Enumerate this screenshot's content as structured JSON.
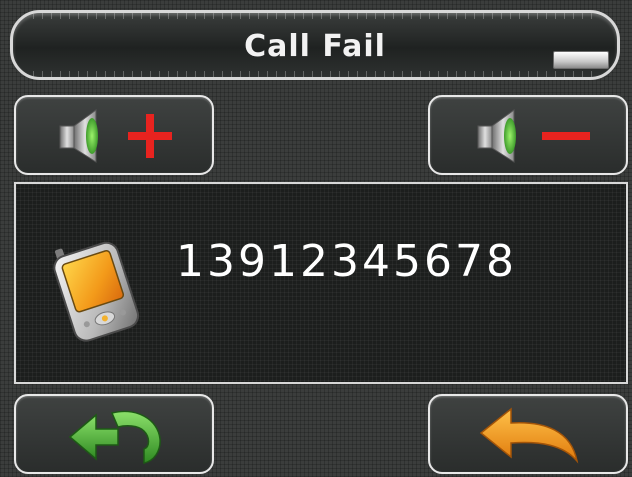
{
  "title": "Call Fail",
  "phone_number": "13912345678",
  "icons": {
    "minimize": "minimize-icon",
    "volume_up": "speaker-plus-icon",
    "volume_down": "speaker-minus-icon",
    "device": "pda-phone-icon",
    "redial": "redial-arrow-icon",
    "back": "back-arrow-icon"
  },
  "colors": {
    "plus": "#e8231f",
    "minus": "#e8231f",
    "redial_arrow": "#4aa83c",
    "back_arrow": "#f29a1b"
  }
}
